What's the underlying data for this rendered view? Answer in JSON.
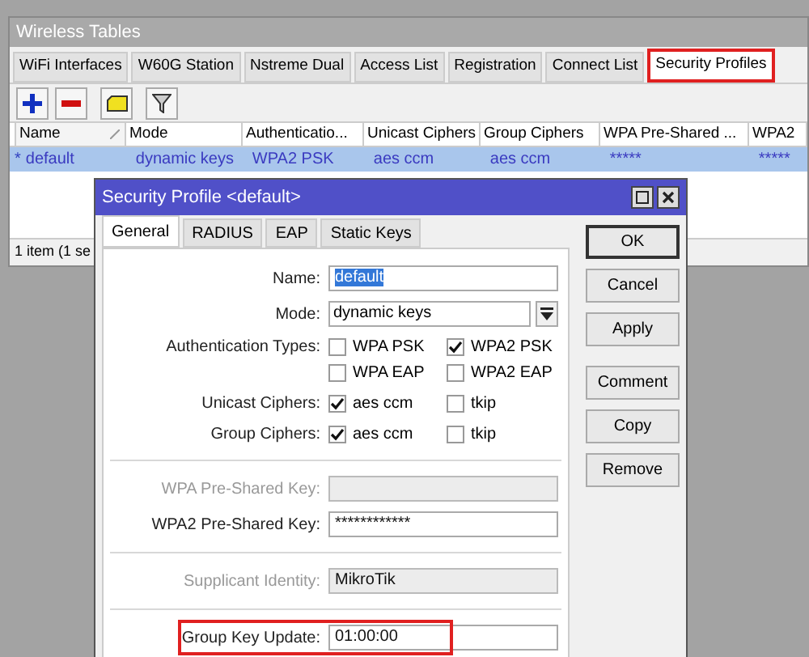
{
  "window": {
    "title": "Wireless Tables",
    "tabs": [
      {
        "label": "WiFi Interfaces",
        "selected": false,
        "highlighted": false
      },
      {
        "label": "W60G Station",
        "selected": false,
        "highlighted": false
      },
      {
        "label": "Nstreme Dual",
        "selected": false,
        "highlighted": false
      },
      {
        "label": "Access List",
        "selected": false,
        "highlighted": false
      },
      {
        "label": "Registration",
        "selected": false,
        "highlighted": false
      },
      {
        "label": "Connect List",
        "selected": false,
        "highlighted": false
      },
      {
        "label": "Security Profiles",
        "selected": true,
        "highlighted": true
      }
    ],
    "table": {
      "columns": [
        {
          "label": "Name",
          "sorted": true
        },
        {
          "label": "Mode",
          "sorted": false
        },
        {
          "label": "Authenticatio...",
          "sorted": false
        },
        {
          "label": "Unicast Ciphers",
          "sorted": false
        },
        {
          "label": "Group Ciphers",
          "sorted": false
        },
        {
          "label": "WPA Pre-Shared ...",
          "sorted": false
        },
        {
          "label": "WPA2",
          "sorted": false
        }
      ],
      "rows": [
        {
          "flag": "*",
          "selected": true,
          "cells": [
            "default",
            "dynamic keys",
            "WPA2 PSK",
            "aes ccm",
            "aes ccm",
            "*****",
            "*****"
          ]
        }
      ]
    },
    "status_bar": "1 item (1 se"
  },
  "dialog": {
    "title": "Security Profile <default>",
    "tabs": [
      {
        "label": "General",
        "selected": true
      },
      {
        "label": "RADIUS",
        "selected": false
      },
      {
        "label": "EAP",
        "selected": false
      },
      {
        "label": "Static Keys",
        "selected": false
      }
    ],
    "fields": [
      {
        "kind": "text",
        "label": "Name:",
        "value": "default",
        "value_highlighted": true,
        "disabled": false,
        "highlighted": false
      },
      {
        "kind": "select",
        "label": "Mode:",
        "value": "dynamic keys",
        "disabled": false,
        "highlighted": false
      },
      {
        "kind": "checks",
        "label": "Authentication Types:",
        "options": [
          {
            "label": "WPA PSK",
            "checked": false
          },
          {
            "label": "WPA2 PSK",
            "checked": true
          },
          {
            "label": "WPA EAP",
            "checked": false
          },
          {
            "label": "WPA2 EAP",
            "checked": false
          }
        ]
      },
      {
        "kind": "checks",
        "label": "Unicast Ciphers:",
        "options": [
          {
            "label": "aes ccm",
            "checked": true
          },
          {
            "label": "tkip",
            "checked": false
          }
        ]
      },
      {
        "kind": "checks",
        "label": "Group Ciphers:",
        "options": [
          {
            "label": "aes ccm",
            "checked": true
          },
          {
            "label": "tkip",
            "checked": false
          }
        ]
      },
      {
        "kind": "separator"
      },
      {
        "kind": "text",
        "label": "WPA Pre-Shared Key:",
        "disabled": true,
        "highlighted": false
      },
      {
        "kind": "text",
        "label": "WPA2 Pre-Shared Key:",
        "value": "************",
        "disabled": false,
        "highlighted": false
      },
      {
        "kind": "separator"
      },
      {
        "kind": "text",
        "label": "Supplicant Identity:",
        "value": "MikroTik",
        "disabled": true,
        "highlighted": false
      },
      {
        "kind": "separator"
      },
      {
        "kind": "text",
        "label": "Group Key Update:",
        "value": "01:00:00",
        "disabled": false,
        "highlighted": true
      }
    ],
    "buttons": [
      {
        "label": "OK",
        "default": true
      },
      {
        "label": "Cancel",
        "default": false
      },
      {
        "label": "Apply",
        "default": false
      },
      {
        "label": "Comment",
        "default": false
      },
      {
        "label": "Copy",
        "default": false
      },
      {
        "label": "Remove",
        "default": false
      }
    ]
  }
}
